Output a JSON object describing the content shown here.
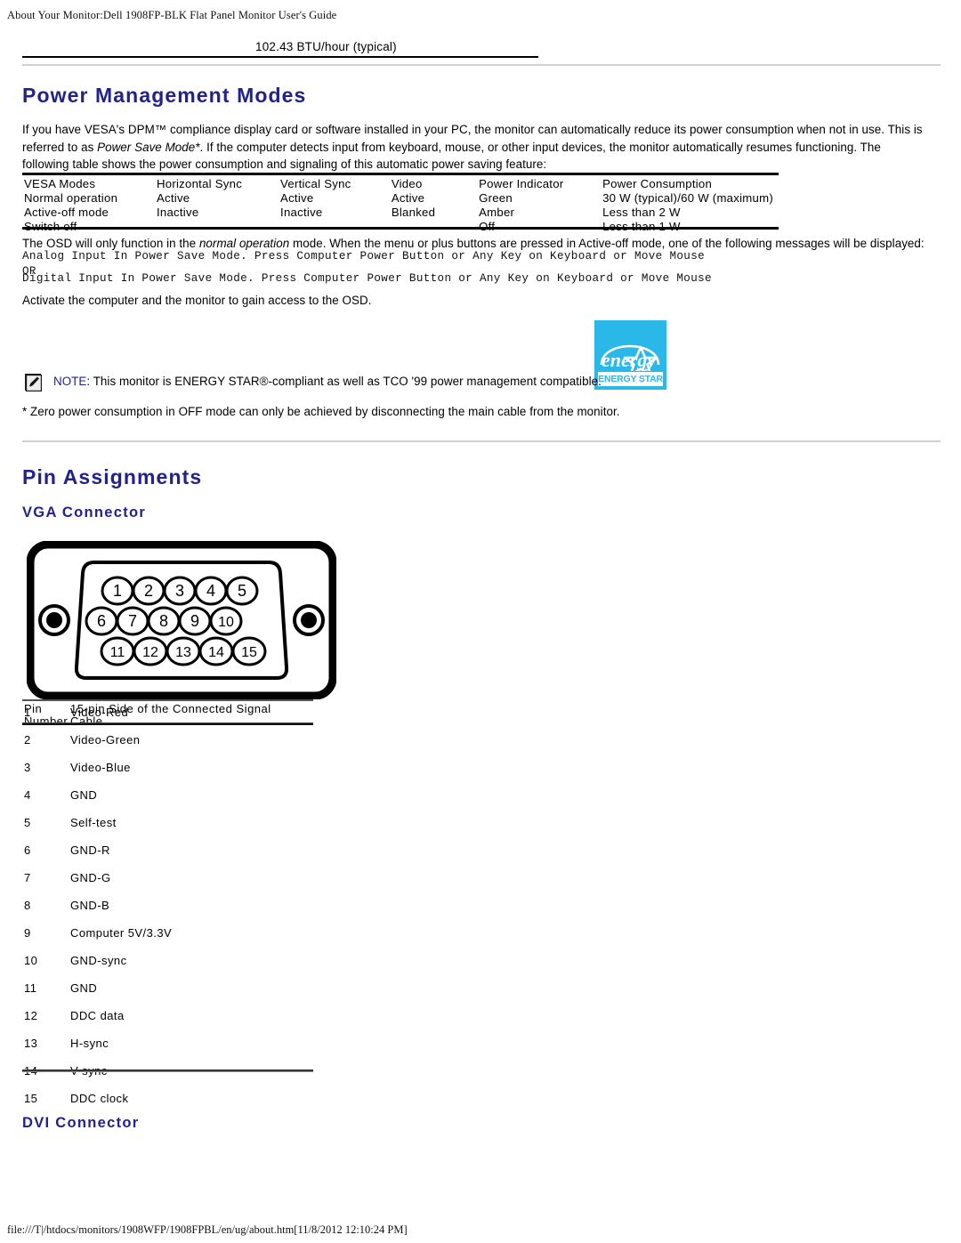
{
  "header": {
    "running_head": "About Your Monitor:Dell 1908FP-BLK Flat Panel Monitor User's Guide"
  },
  "btu_row": {
    "left_cell": "",
    "right_cell": "102.43 BTU/hour (typical)"
  },
  "power_management": {
    "title": "Power Management Modes",
    "intro_1": "If you have VESA's DPM™ compliance display card or software installed in your PC, the monitor can automatically reduce its power consumption when not in use. This is referred to as ",
    "intro_italic": "Power Save Mode*",
    "intro_2": ". If the computer detects input from keyboard, mouse, or other input devices, the monitor automatically resumes functioning. The following table shows the power consumption and signaling of this automatic power saving feature:",
    "table": {
      "headers": [
        "VESA Modes",
        "Horizontal Sync",
        "Vertical Sync",
        "Video",
        "Power Indicator",
        "Power Consumption"
      ],
      "rows": [
        [
          "Normal operation",
          "Active",
          "Active",
          "Active",
          "Green",
          "30 W (typical)/60 W (maximum)"
        ],
        [
          "Active-off mode",
          "Inactive",
          "Inactive",
          "Blanked",
          "Amber",
          "Less than 2 W"
        ],
        [
          "Switch off",
          "-",
          "-",
          "-",
          "Off",
          "Less than 1 W"
        ]
      ]
    },
    "osd_note_1": "The OSD will only function in the ",
    "osd_note_italic": "normal operation",
    "osd_note_2": " mode. When the menu or plus buttons are pressed in Active-off mode, one of the following messages will be displayed:",
    "message_analog": "Analog Input In Power Save Mode. Press Computer Power Button or Any Key on Keyboard or Move Mouse",
    "message_or": "OR",
    "message_digital": "Digital Input In Power Save Mode. Press Computer Power Button or Any Key on Keyboard or Move Mouse",
    "activate_text": "Activate the computer and the monitor to gain access to the OSD.",
    "note_label": "NOTE",
    "note_text": ": This monitor is ENERGY STAR®-compliant as well as TCO '99 power management compatible.",
    "footnote": "* Zero power consumption in OFF mode can only be achieved by disconnecting the main cable from the monitor.",
    "energy_star_label": "ENERGY STAR"
  },
  "pin_assignments": {
    "title": "Pin Assignments",
    "vga_title": "VGA Connector",
    "dvi_title": "DVI Connector",
    "connector_pins": [
      "1",
      "2",
      "3",
      "4",
      "5",
      "6",
      "7",
      "8",
      "9",
      "10",
      "11",
      "12",
      "13",
      "14",
      "15"
    ],
    "table": {
      "header_col1_line1": "Pin",
      "header_col1_line2": "Number",
      "header_col2_line1": "15-pin Side of the Connected Signal",
      "header_col2_line2": "Cable",
      "rows": [
        {
          "pin": "1",
          "signal": "Video-Red"
        },
        {
          "pin": "2",
          "signal": "Video-Green"
        },
        {
          "pin": "3",
          "signal": "Video-Blue"
        },
        {
          "pin": "4",
          "signal": "GND"
        },
        {
          "pin": "5",
          "signal": "Self-test"
        },
        {
          "pin": "6",
          "signal": "GND-R"
        },
        {
          "pin": "7",
          "signal": "GND-G"
        },
        {
          "pin": "8",
          "signal": "GND-B"
        },
        {
          "pin": "9",
          "signal": "Computer 5V/3.3V"
        },
        {
          "pin": "10",
          "signal": "GND-sync"
        },
        {
          "pin": "11",
          "signal": "GND"
        },
        {
          "pin": "12",
          "signal": "DDC data"
        },
        {
          "pin": "13",
          "signal": "H-sync"
        },
        {
          "pin": "14",
          "signal": "V-sync"
        },
        {
          "pin": "15",
          "signal": "DDC clock"
        }
      ]
    }
  },
  "footer": {
    "path": "file:///T|/htdocs/monitors/1908WFP/1908FPBL/en/ug/about.htm[11/8/2012 12:10:24 PM]"
  },
  "colors": {
    "heading_blue": "#22228c",
    "energy_star_cyan": "#29b8e8",
    "rule_gray": "#d0d0d0"
  }
}
